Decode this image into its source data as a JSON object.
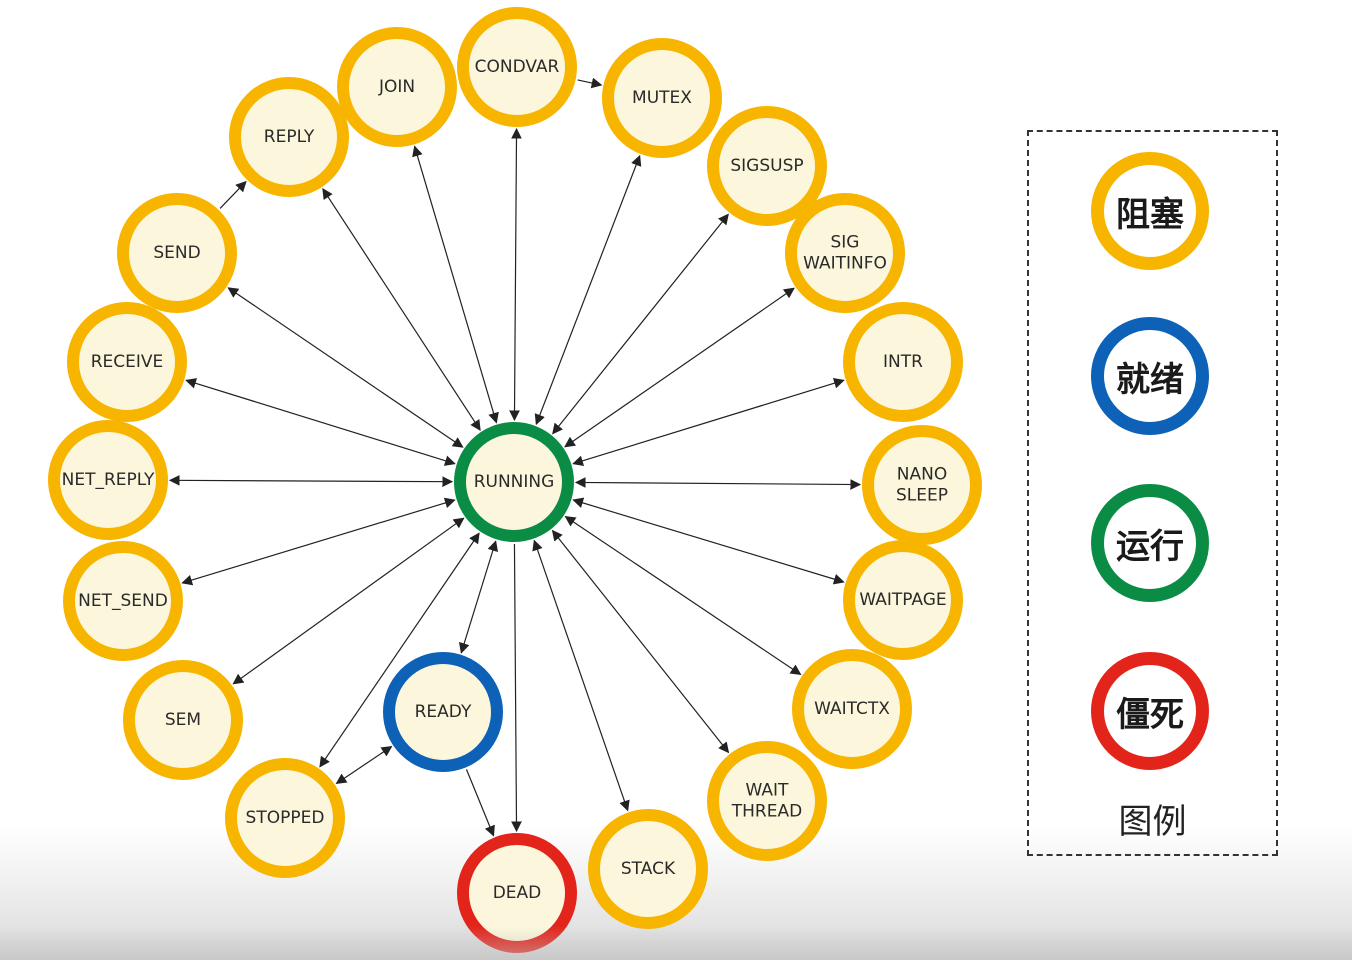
{
  "colors": {
    "blocked": "#F7B500",
    "ready": "#0D62B8",
    "running": "#0B8C45",
    "dead": "#E3241B",
    "node_fill": "#FCF7DC",
    "edge": "#222222"
  },
  "nodes": [
    {
      "id": "running",
      "label": [
        "RUNNING"
      ],
      "state": "running"
    },
    {
      "id": "condvar",
      "label": [
        "CONDVAR"
      ],
      "state": "blocked"
    },
    {
      "id": "join",
      "label": [
        "JOIN"
      ],
      "state": "blocked"
    },
    {
      "id": "reply",
      "label": [
        "REPLY"
      ],
      "state": "blocked"
    },
    {
      "id": "send",
      "label": [
        "SEND"
      ],
      "state": "blocked"
    },
    {
      "id": "receive",
      "label": [
        "RECEIVE"
      ],
      "state": "blocked"
    },
    {
      "id": "net_reply",
      "label": [
        "NET_REPLY"
      ],
      "state": "blocked"
    },
    {
      "id": "net_send",
      "label": [
        "NET_SEND"
      ],
      "state": "blocked"
    },
    {
      "id": "sem",
      "label": [
        "SEM"
      ],
      "state": "blocked"
    },
    {
      "id": "stopped",
      "label": [
        "STOPPED"
      ],
      "state": "blocked"
    },
    {
      "id": "ready",
      "label": [
        "READY"
      ],
      "state": "ready"
    },
    {
      "id": "dead",
      "label": [
        "DEAD"
      ],
      "state": "dead"
    },
    {
      "id": "stack",
      "label": [
        "STACK"
      ],
      "state": "blocked"
    },
    {
      "id": "waitthread",
      "label": [
        "WAIT",
        "THREAD"
      ],
      "state": "blocked"
    },
    {
      "id": "waitctx",
      "label": [
        "WAITCTX"
      ],
      "state": "blocked"
    },
    {
      "id": "waitpage",
      "label": [
        "WAITPAGE"
      ],
      "state": "blocked"
    },
    {
      "id": "nanosleep",
      "label": [
        "NANO",
        "SLEEP"
      ],
      "state": "blocked"
    },
    {
      "id": "intr",
      "label": [
        "INTR"
      ],
      "state": "blocked"
    },
    {
      "id": "sigwaitinfo",
      "label": [
        "SIG",
        "WAITINFO"
      ],
      "state": "blocked"
    },
    {
      "id": "sigsusp",
      "label": [
        "SIGSUSP"
      ],
      "state": "blocked"
    },
    {
      "id": "mutex",
      "label": [
        "MUTEX"
      ],
      "state": "blocked"
    }
  ],
  "edges": [
    {
      "from": "running",
      "to": "condvar",
      "dir": "both"
    },
    {
      "from": "running",
      "to": "join",
      "dir": "both"
    },
    {
      "from": "running",
      "to": "reply",
      "dir": "both"
    },
    {
      "from": "running",
      "to": "send",
      "dir": "both"
    },
    {
      "from": "running",
      "to": "receive",
      "dir": "both"
    },
    {
      "from": "running",
      "to": "net_reply",
      "dir": "both"
    },
    {
      "from": "running",
      "to": "net_send",
      "dir": "both"
    },
    {
      "from": "running",
      "to": "sem",
      "dir": "both"
    },
    {
      "from": "running",
      "to": "stopped",
      "dir": "both"
    },
    {
      "from": "running",
      "to": "ready",
      "dir": "both"
    },
    {
      "from": "running",
      "to": "dead",
      "dir": "forward"
    },
    {
      "from": "running",
      "to": "stack",
      "dir": "both"
    },
    {
      "from": "running",
      "to": "waitthread",
      "dir": "both"
    },
    {
      "from": "running",
      "to": "waitctx",
      "dir": "both"
    },
    {
      "from": "running",
      "to": "waitpage",
      "dir": "both"
    },
    {
      "from": "running",
      "to": "nanosleep",
      "dir": "both"
    },
    {
      "from": "running",
      "to": "intr",
      "dir": "both"
    },
    {
      "from": "running",
      "to": "sigwaitinfo",
      "dir": "both"
    },
    {
      "from": "running",
      "to": "sigsusp",
      "dir": "both"
    },
    {
      "from": "running",
      "to": "mutex",
      "dir": "both"
    },
    {
      "from": "stopped",
      "to": "ready",
      "dir": "both"
    },
    {
      "from": "ready",
      "to": "dead",
      "dir": "forward"
    },
    {
      "from": "send",
      "to": "reply",
      "dir": "forward"
    },
    {
      "from": "condvar",
      "to": "mutex",
      "dir": "forward"
    }
  ],
  "legend": {
    "items": [
      {
        "label": "阻塞",
        "state": "blocked"
      },
      {
        "label": "就绪",
        "state": "ready"
      },
      {
        "label": "运行",
        "state": "running"
      },
      {
        "label": "僵死",
        "state": "dead"
      }
    ],
    "caption": "图例"
  }
}
